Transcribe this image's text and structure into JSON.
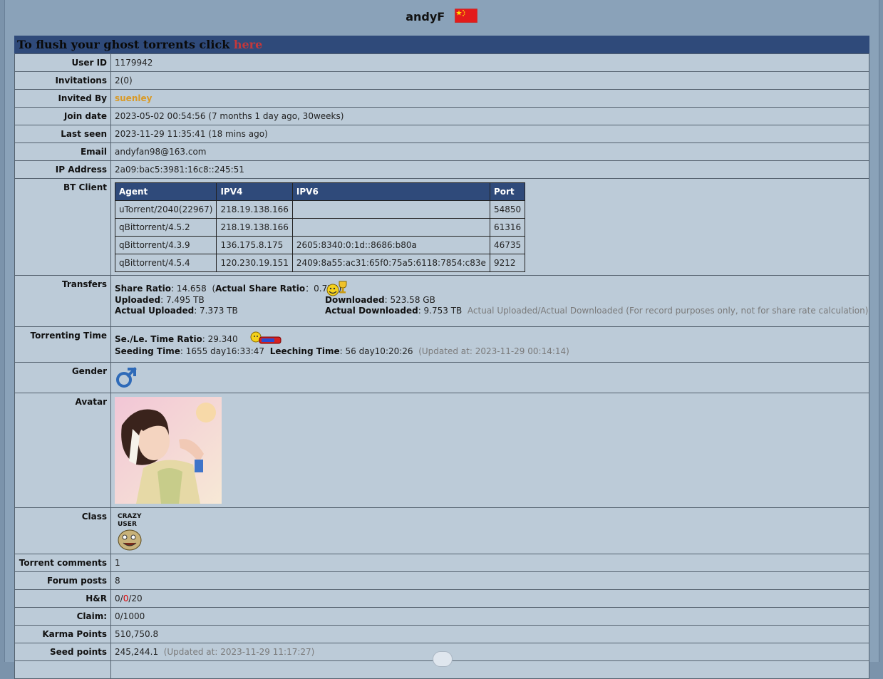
{
  "header": {
    "username": "andyF"
  },
  "banner": {
    "text": "To flush your ghost torrents click ",
    "link": "here"
  },
  "labels": {
    "user_id": "User ID",
    "invitations": "Invitations",
    "invited_by": "Invited By",
    "join_date": "Join date",
    "last_seen": "Last seen",
    "email": "Email",
    "ip_address": "IP Address",
    "bt_client": "BT Client",
    "transfers": "Transfers",
    "torrenting_time": "Torrenting Time",
    "gender": "Gender",
    "avatar": "Avatar",
    "class": "Class",
    "torrent_comments": "Torrent comments",
    "forum_posts": "Forum posts",
    "hr": "H&R",
    "claim": "Claim:",
    "karma_points": "Karma Points",
    "seed_points": "Seed points"
  },
  "values": {
    "user_id": "1179942",
    "invitations": "2(0)",
    "invited_by": "suenley",
    "join_date": "2023-05-02 00:54:56 (7 months 1 day ago, 30weeks)",
    "last_seen": "2023-11-29 11:35:41 (18 mins ago)",
    "email": "andyfan98@163.com",
    "ip_address": "2a09:bac5:3981:16c8::245:51",
    "torrent_comments": "1",
    "forum_posts": "8",
    "hr_a": "0/",
    "hr_b": "0",
    "hr_c": "/20",
    "claim": "0/1000",
    "karma_points": "510,750.8",
    "seed_points": "245,244.1",
    "seed_points_updated": "(Updated at: 2023-11-29 11:17:27)"
  },
  "bt_client": {
    "headers": [
      "Agent",
      "IPV4",
      "IPV6",
      "Port"
    ],
    "rows": [
      [
        "uTorrent/2040(22967)",
        "218.19.138.166",
        "",
        "54850"
      ],
      [
        "qBittorrent/4.5.2",
        "218.19.138.166",
        "",
        "61316"
      ],
      [
        "qBittorrent/4.3.9",
        "136.175.8.175",
        "2605:8340:0:1d::8686:b80a",
        "46735"
      ],
      [
        "qBittorrent/4.5.4",
        "120.230.19.151",
        "2409:8a55:ac31:65f0:75a5:6118:7854:c83e",
        "9212"
      ]
    ]
  },
  "transfers": {
    "share_ratio_label": "Share Ratio",
    "share_ratio": ": 14.658",
    "actual_share_ratio_label": "Actual Share Ratio",
    "actual_share_ratio": "：0.755)",
    "uploaded_label": "Uploaded",
    "uploaded": ": 7.495 TB",
    "actual_uploaded_label": "Actual Uploaded",
    "actual_uploaded": ": 7.373 TB",
    "downloaded_label": "Downloaded",
    "downloaded": ": 523.58 GB",
    "actual_downloaded_label": "Actual Downloaded",
    "actual_downloaded": ": 9.753 TB",
    "note": "Actual Uploaded/Actual Downloaded (For record purposes only, not for share rate calculation)"
  },
  "torrenting": {
    "ratio_label": "Se./Le. Time Ratio",
    "ratio": ": 29.340",
    "seeding_label": "Seeding Time",
    "seeding": ": 1655 day16:33:47",
    "leeching_label": "Leeching Time",
    "leeching": ": 56 day10:20:26",
    "updated": "(Updated at: 2023-11-29 00:14:14)"
  },
  "class_badge": {
    "line1": "CRAZY",
    "line2": "USER"
  },
  "colors": {
    "banner_bg": "#2f4a7a",
    "row_bg": "#bccbd8",
    "link_red": "#c4383b",
    "invited_gold": "#d99a26"
  }
}
